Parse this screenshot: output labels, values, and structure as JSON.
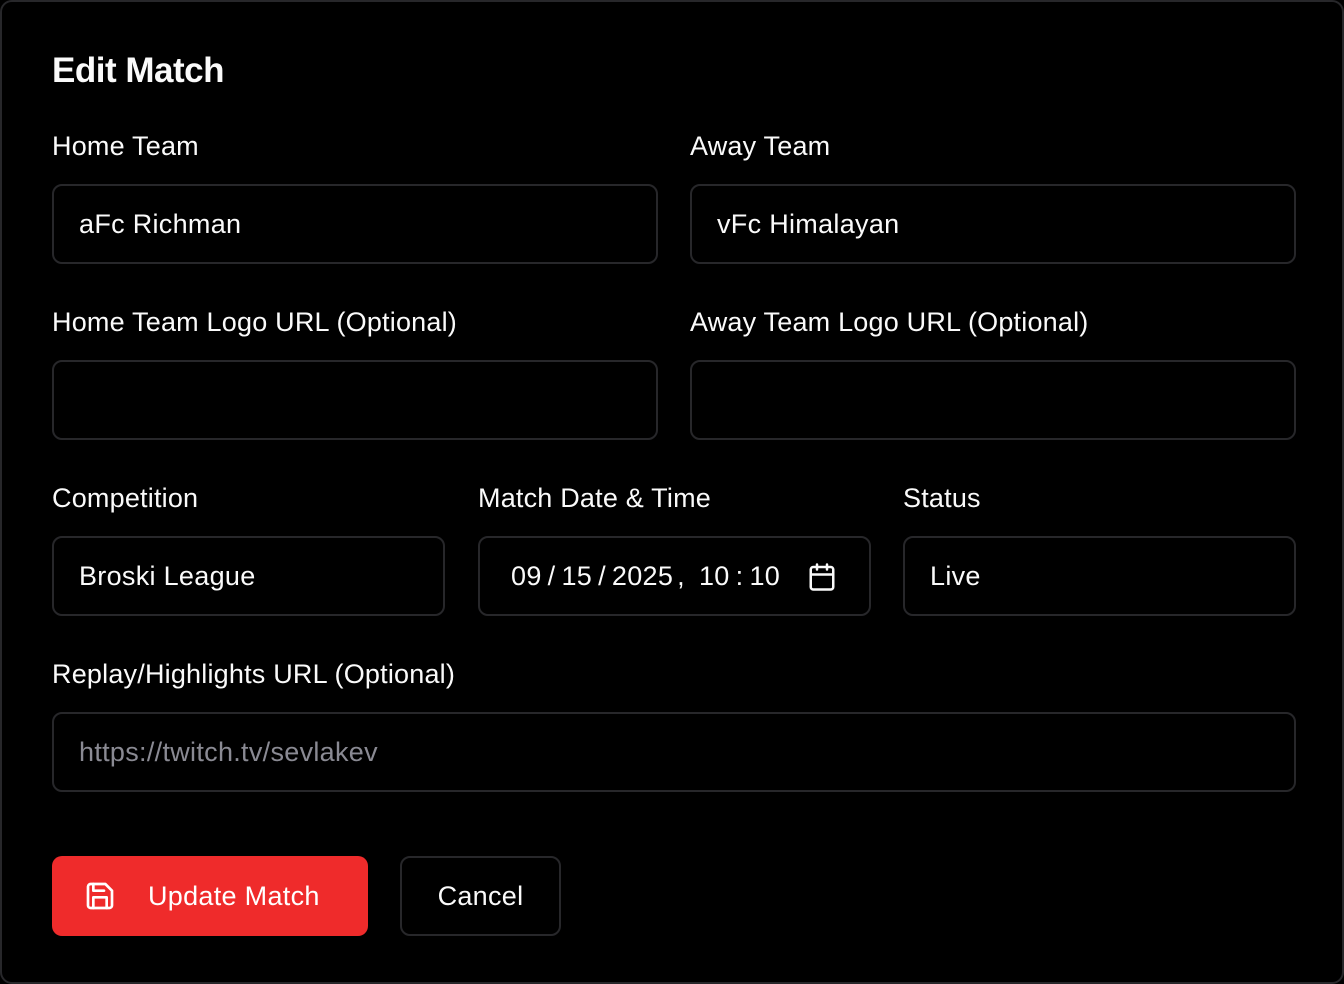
{
  "dialog": {
    "title": "Edit Match"
  },
  "form": {
    "home_team": {
      "label": "Home Team",
      "value": "aFc Richman"
    },
    "away_team": {
      "label": "Away Team",
      "value": "vFc Himalayan"
    },
    "home_logo": {
      "label": "Home Team Logo URL (Optional)",
      "value": ""
    },
    "away_logo": {
      "label": "Away Team Logo URL (Optional)",
      "value": ""
    },
    "competition": {
      "label": "Competition",
      "value": "Broski League"
    },
    "match_datetime": {
      "label": "Match Date & Time",
      "month": "09",
      "day": "15",
      "year": "2025",
      "hour": "10",
      "minute": "10"
    },
    "status": {
      "label": "Status",
      "value": "Live"
    },
    "replay_url": {
      "label": "Replay/Highlights URL (Optional)",
      "placeholder": "https://twitch.tv/sevlakev"
    }
  },
  "actions": {
    "update_label": "Update Match",
    "cancel_label": "Cancel"
  },
  "icons": {
    "save": "save-icon",
    "calendar": "calendar-icon"
  },
  "colors": {
    "background": "#000000",
    "border": "#27272a",
    "text": "#fafafa",
    "placeholder": "#8a8a93",
    "primary": "#ef2b2b"
  }
}
